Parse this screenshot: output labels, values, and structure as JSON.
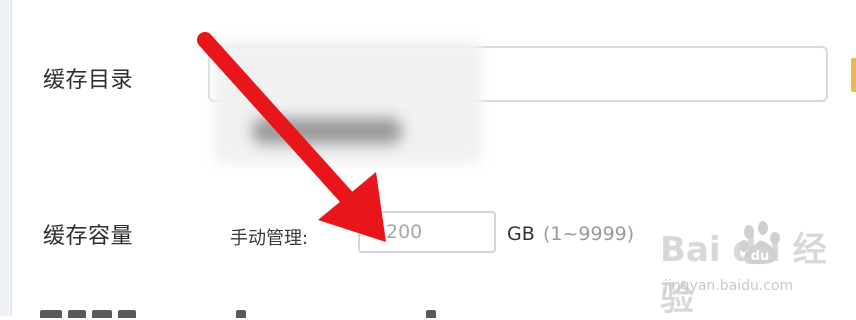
{
  "settings": {
    "cache_dir_label": "缓存目录",
    "cache_capacity_label": "缓存容量",
    "cache_dir_value": "",
    "manual_mode_label": "手动管理:",
    "capacity_value": "200",
    "capacity_unit": "GB",
    "capacity_range": "(1~9999)"
  },
  "watermark": {
    "brand": "Bai du 经验",
    "url": "jingyan.baidu.com"
  },
  "colors": {
    "arrow": "#e8161b",
    "input_border": "#d6d9df",
    "accent_edge": "#f0b84a"
  },
  "icons": [
    "red-arrow-annotation",
    "baidu-paw-logo"
  ]
}
